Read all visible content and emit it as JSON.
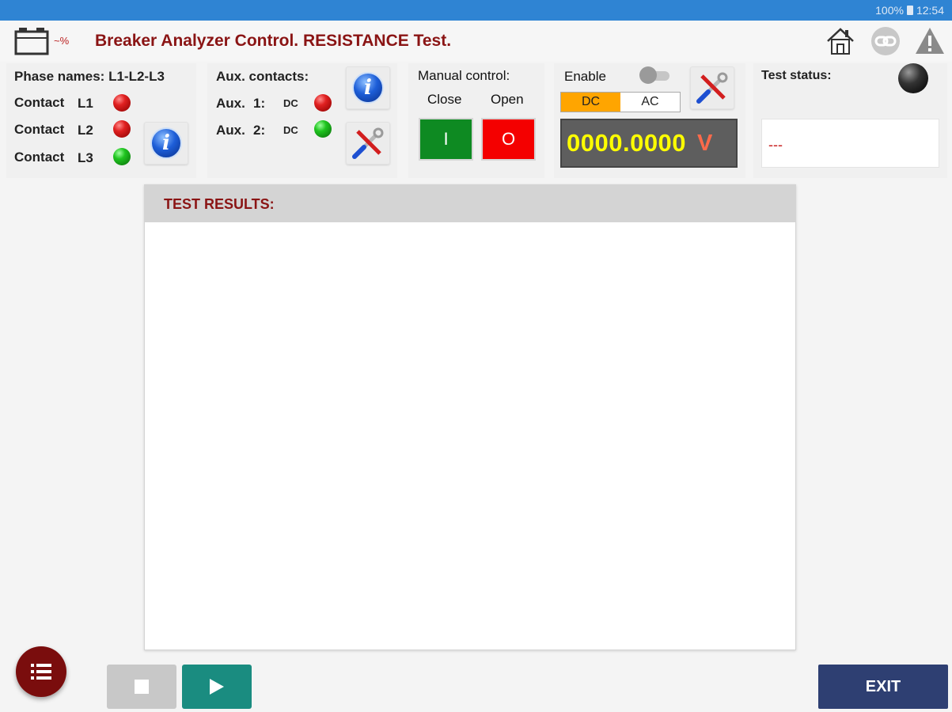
{
  "status_bar": {
    "battery": "100%",
    "time": "12:54"
  },
  "header": {
    "title": "Breaker Analyzer Control. RESISTANCE Test.",
    "app_icon_label": "~%"
  },
  "phase": {
    "names_label": "Phase names:",
    "names_value": "L1-L2-L3",
    "contacts": [
      {
        "label": "Contact",
        "phase": "L1",
        "state": "red"
      },
      {
        "label": "Contact",
        "phase": "L2",
        "state": "red"
      },
      {
        "label": "Contact",
        "phase": "L3",
        "state": "green"
      }
    ]
  },
  "aux": {
    "title": "Aux. contacts:",
    "items": [
      {
        "label": "Aux.",
        "num": "1:",
        "type": "DC",
        "state": "red"
      },
      {
        "label": "Aux.",
        "num": "2:",
        "type": "DC",
        "state": "green"
      }
    ]
  },
  "manual": {
    "title": "Manual control:",
    "close_label": "Close",
    "open_label": "Open",
    "close_btn": "I",
    "open_btn": "O"
  },
  "voltage": {
    "enable_label": "Enable",
    "enable_on": false,
    "mode_dc": "DC",
    "mode_ac": "AC",
    "selected_mode": "DC",
    "reading": "0000.0000",
    "unit": "V"
  },
  "test_status": {
    "label": "Test status:",
    "value": "---"
  },
  "results": {
    "header": "TEST RESULTS:"
  },
  "footer": {
    "exit_label": "EXIT"
  },
  "colors": {
    "title": "#8a1414",
    "status_bar": "#2f84d3",
    "exit": "#2e3f72",
    "play": "#1a8c80",
    "close": "#0e8a22",
    "open": "#f40000",
    "dc_active": "#ffa500"
  }
}
